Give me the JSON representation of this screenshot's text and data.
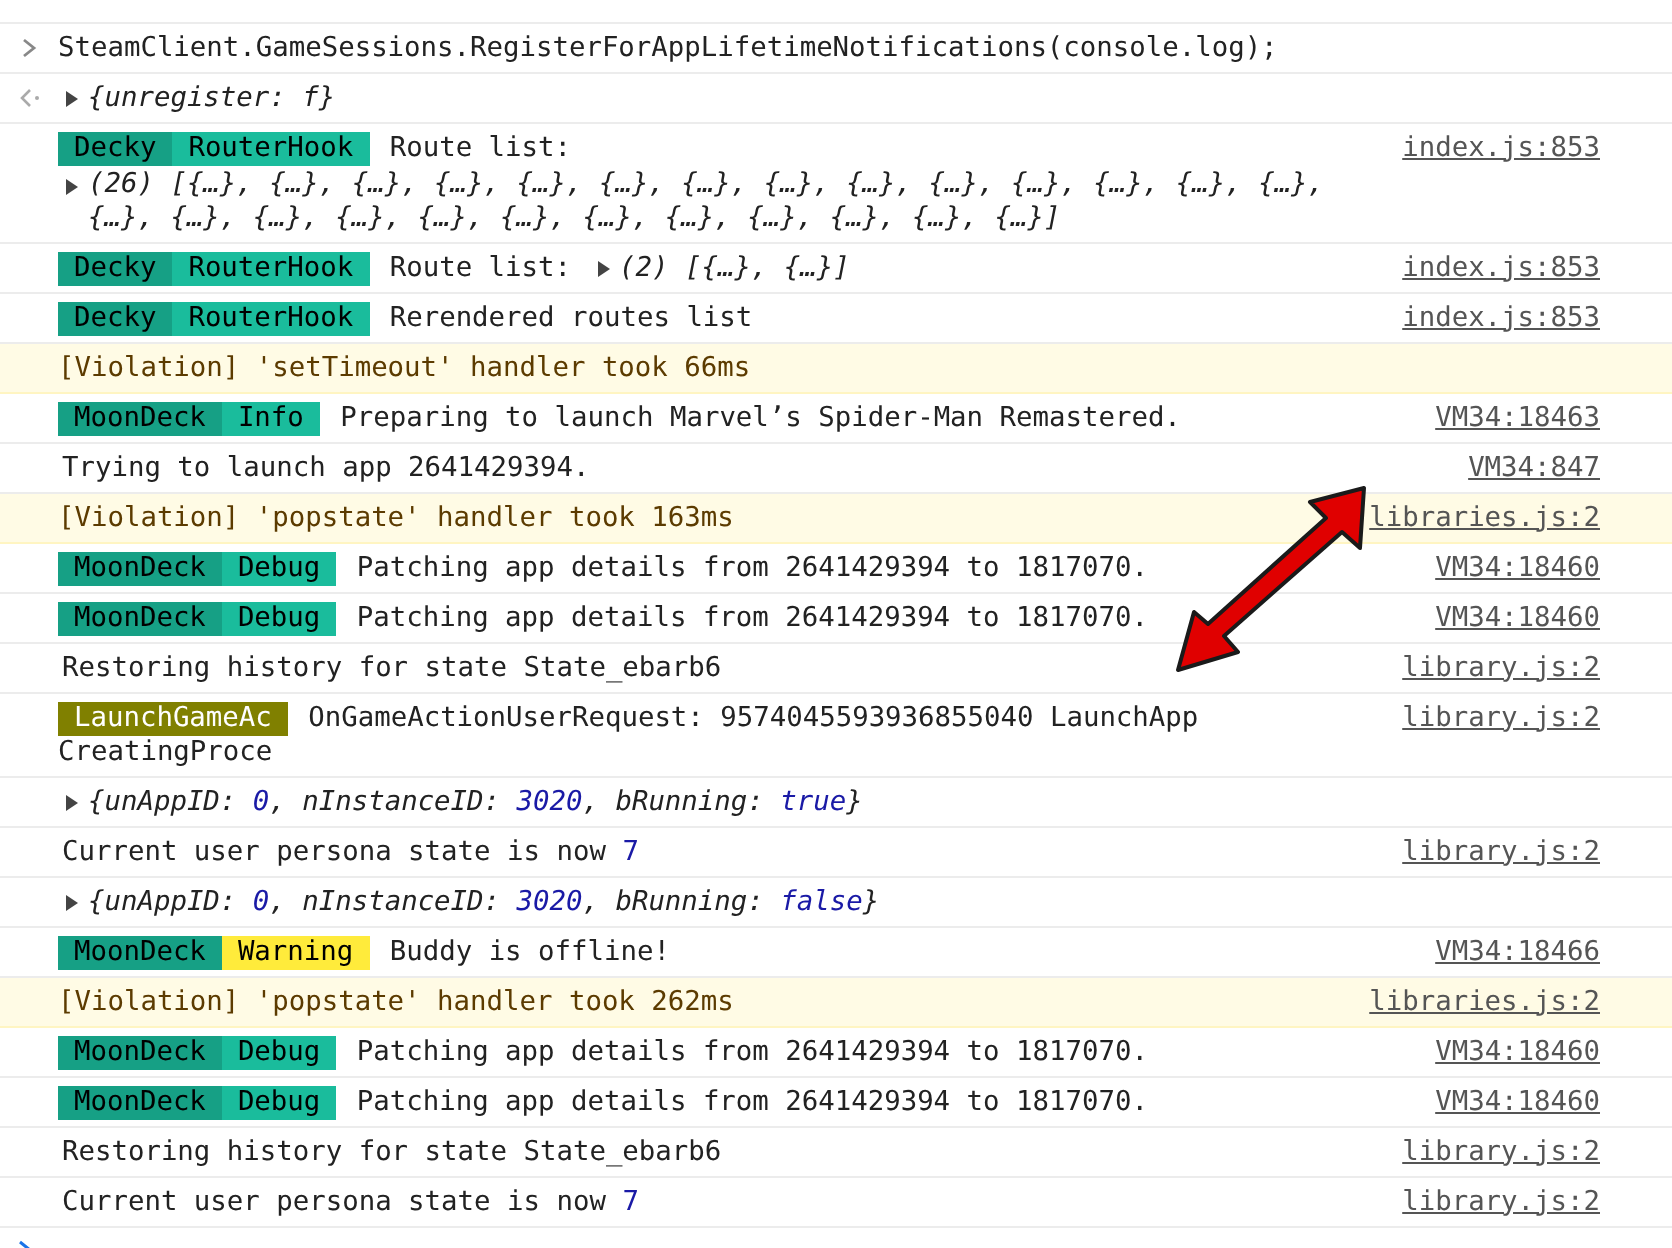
{
  "entries": [
    {
      "kind": "command",
      "message": "SteamClient.GameSessions.RegisterForAppLifetimeNotifications(console.log);"
    },
    {
      "kind": "result",
      "segments": [
        {
          "text": "{unregister: f}"
        }
      ]
    },
    {
      "kind": "log",
      "badges": [
        {
          "text": "Decky",
          "color": "#16a085"
        },
        {
          "text": "RouterHook",
          "color": "#1abc9c"
        }
      ],
      "message": "Route list:",
      "object_below": "(26) [{…}, {…}, {…}, {…}, {…}, {…}, {…}, {…}, {…}, {…}, {…}, {…}, {…}, {…}, {…}, {…}, {…}, {…}, {…}, {…}, {…}, {…}, {…}, {…}, {…}, {…}]",
      "source": "index.js:853"
    },
    {
      "kind": "log",
      "badges": [
        {
          "text": "Decky",
          "color": "#16a085"
        },
        {
          "text": "RouterHook",
          "color": "#1abc9c"
        }
      ],
      "message": "Route list:",
      "inline_object": "(2) [{…}, {…}]",
      "source": "index.js:853"
    },
    {
      "kind": "log",
      "badges": [
        {
          "text": "Decky",
          "color": "#16a085"
        },
        {
          "text": "RouterHook",
          "color": "#1abc9c"
        }
      ],
      "message": "Rerendered routes list",
      "source": "index.js:853"
    },
    {
      "kind": "violation",
      "message": "[Violation] 'setTimeout' handler took 66ms"
    },
    {
      "kind": "log",
      "badges": [
        {
          "text": "MoonDeck",
          "color": "#16a085"
        },
        {
          "text": "Info",
          "color": "#1abc9c"
        }
      ],
      "message": "Preparing to launch Marvel’s Spider-Man Remastered.",
      "source": "VM34:18463"
    },
    {
      "kind": "log",
      "message": "Trying to launch app 2641429394.",
      "source": "VM34:847"
    },
    {
      "kind": "violation",
      "message": "[Violation] 'popstate' handler took 163ms",
      "source": "libraries.js:2"
    },
    {
      "kind": "log",
      "badges": [
        {
          "text": "MoonDeck",
          "color": "#16a085"
        },
        {
          "text": "Debug",
          "color": "#1abc9c"
        }
      ],
      "message": "Patching app details from 2641429394 to 1817070.",
      "source": "VM34:18460"
    },
    {
      "kind": "log",
      "badges": [
        {
          "text": "MoonDeck",
          "color": "#16a085"
        },
        {
          "text": "Debug",
          "color": "#1abc9c"
        }
      ],
      "message": "Patching app details from 2641429394 to 1817070.",
      "source": "VM34:18460"
    },
    {
      "kind": "log",
      "message": "Restoring history for state State_ebarb6",
      "source": "library.js:2"
    },
    {
      "kind": "log",
      "badges": [
        {
          "text": "LaunchGameAc",
          "color": "#808000"
        }
      ],
      "message": "OnGameActionUserRequest: 9574045593936855040 LaunchApp",
      "continuation": "CreatingProce",
      "source": "library.js:2"
    },
    {
      "kind": "object",
      "segments": [
        {
          "text": "{unAppID: "
        },
        {
          "text": "0",
          "literal": true
        },
        {
          "text": ", nInstanceID: "
        },
        {
          "text": "3020",
          "literal": true
        },
        {
          "text": ", bRunning: "
        },
        {
          "text": "true",
          "literal": true
        },
        {
          "text": "}"
        }
      ]
    },
    {
      "kind": "log",
      "message": "Current user persona state is now",
      "value": "7",
      "source": "library.js:2"
    },
    {
      "kind": "object",
      "segments": [
        {
          "text": "{unAppID: "
        },
        {
          "text": "0",
          "literal": true
        },
        {
          "text": ", nInstanceID: "
        },
        {
          "text": "3020",
          "literal": true
        },
        {
          "text": ", bRunning: "
        },
        {
          "text": "false",
          "literal": true
        },
        {
          "text": "}"
        }
      ]
    },
    {
      "kind": "log",
      "badges": [
        {
          "text": "MoonDeck",
          "color": "#16a085"
        },
        {
          "text": "Warning",
          "color": "#ffeb3b"
        }
      ],
      "message": "Buddy is offline!",
      "source": "VM34:18466"
    },
    {
      "kind": "violation",
      "message": "[Violation] 'popstate' handler took 262ms",
      "source": "libraries.js:2"
    },
    {
      "kind": "log",
      "badges": [
        {
          "text": "MoonDeck",
          "color": "#16a085"
        },
        {
          "text": "Debug",
          "color": "#1abc9c"
        }
      ],
      "message": "Patching app details from 2641429394 to 1817070.",
      "source": "VM34:18460"
    },
    {
      "kind": "log",
      "badges": [
        {
          "text": "MoonDeck",
          "color": "#16a085"
        },
        {
          "text": "Debug",
          "color": "#1abc9c"
        }
      ],
      "message": "Patching app details from 2641429394 to 1817070.",
      "source": "VM34:18460"
    },
    {
      "kind": "log",
      "message": "Restoring history for state State_ebarb6",
      "source": "library.js:2"
    },
    {
      "kind": "log",
      "message": "Current user persona state is now",
      "value": "7",
      "source": "library.js:2"
    }
  ]
}
